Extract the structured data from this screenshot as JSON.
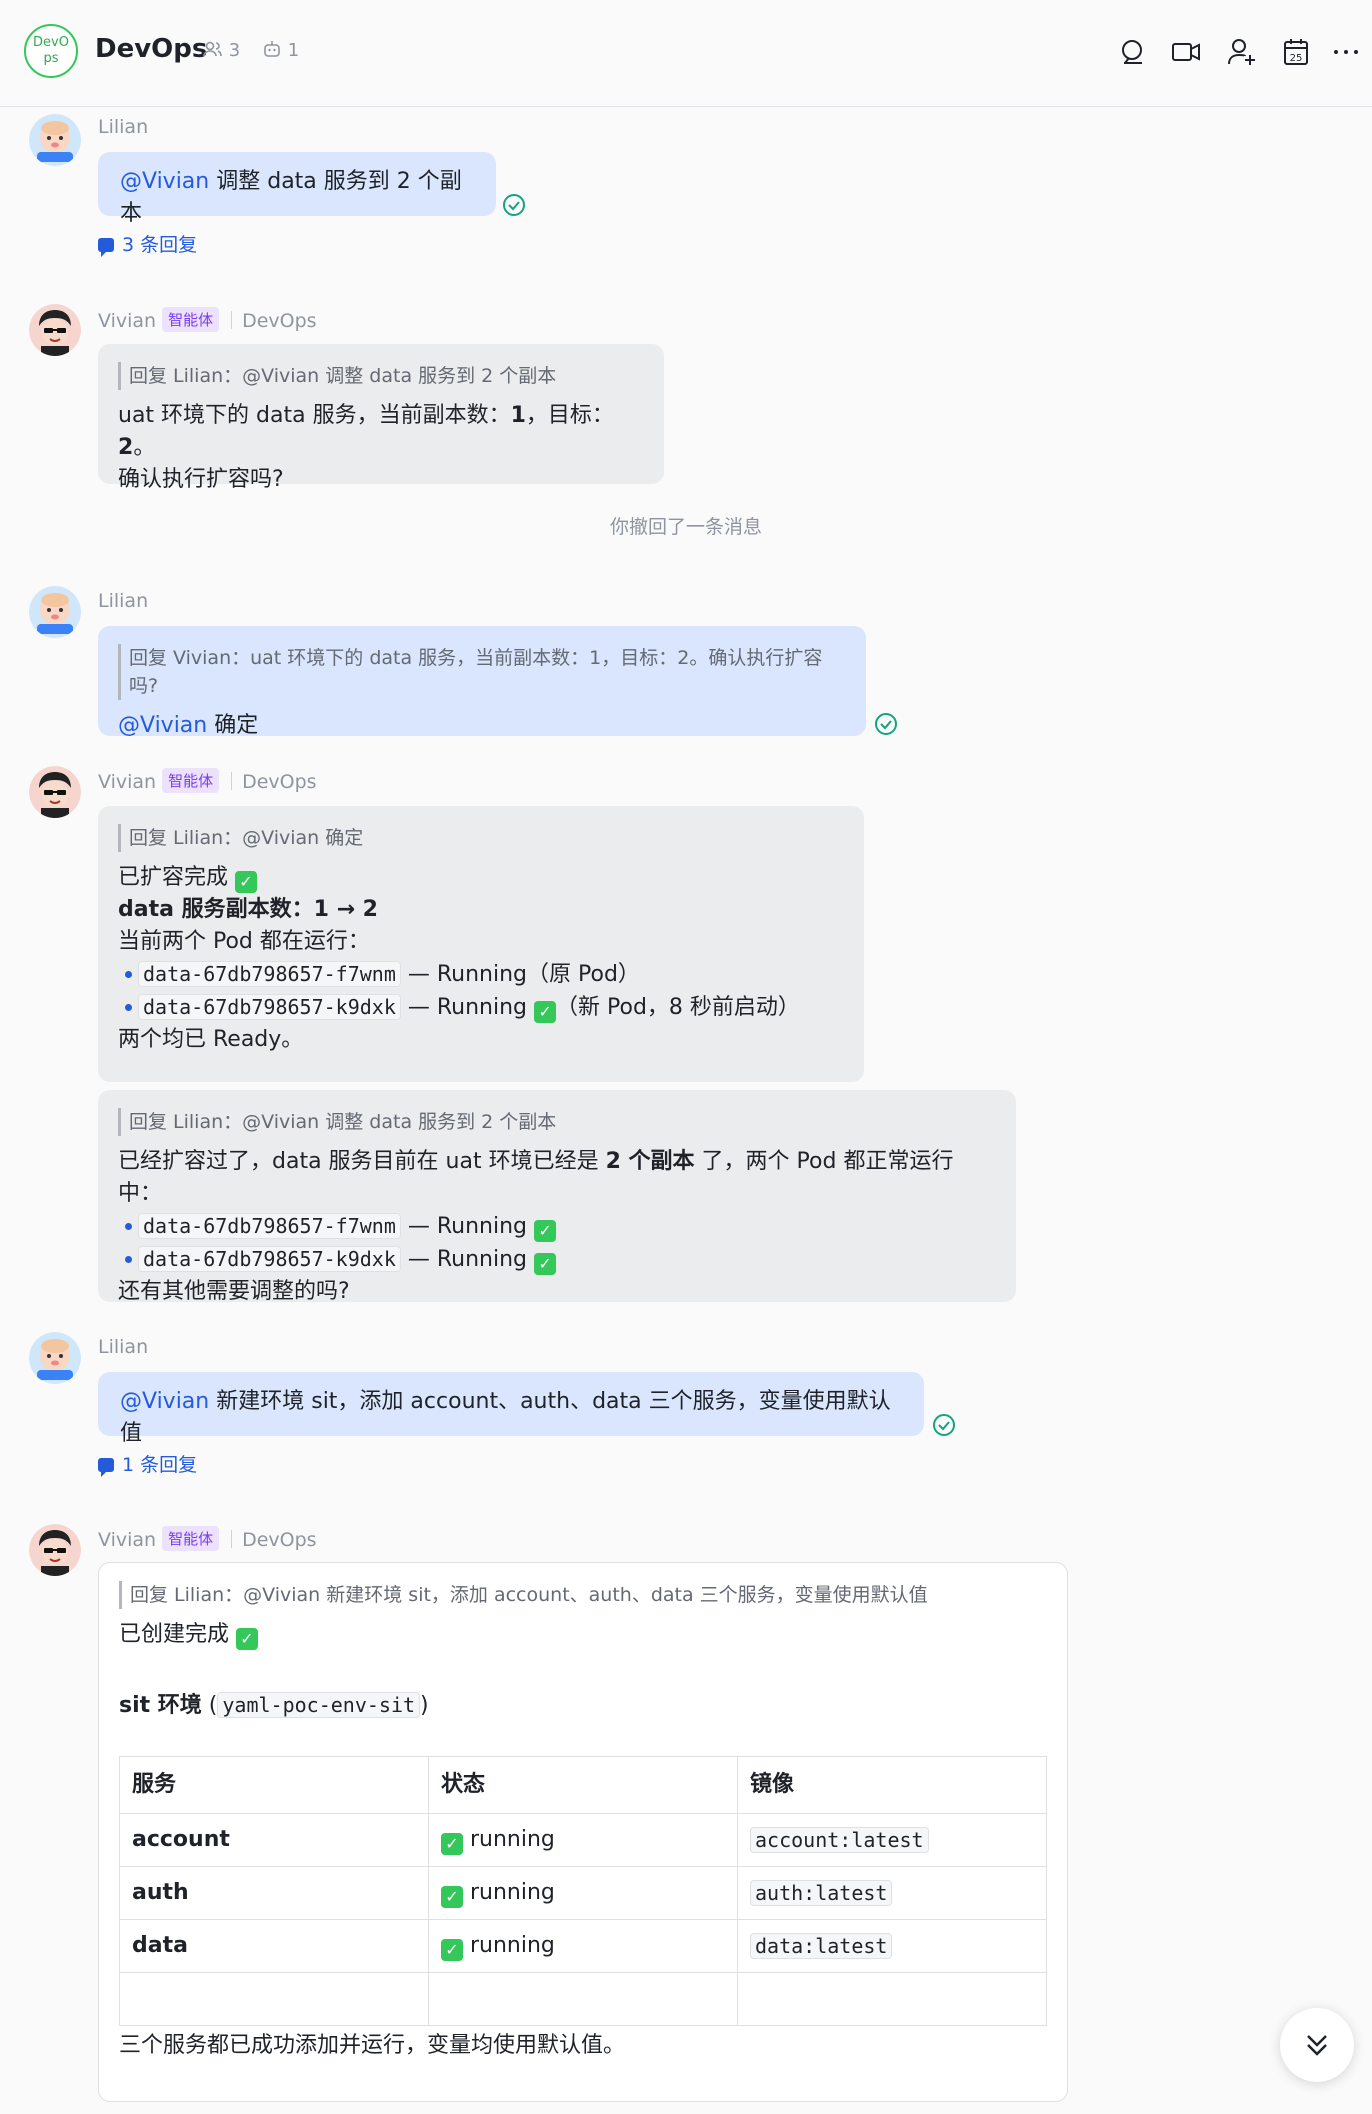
{
  "header": {
    "group_avatar_text": "DevOps",
    "title": "DevOps",
    "member_count": "3",
    "bot_count": "1",
    "icons": [
      "search-icon",
      "video-icon",
      "add-member-icon",
      "calendar-icon",
      "more-icon"
    ],
    "calendar_day": "25"
  },
  "msg1": {
    "sender": "Lilian",
    "mention": "@Vivian",
    "text": " 调整 data 服务到 2 个副本",
    "replies": "3 条回复"
  },
  "msg2": {
    "sender": "Vivian",
    "tag": "智能体",
    "group": "DevOps",
    "quote": "回复 Lilian：@Vivian 调整 data 服务到 2 个副本",
    "line1_a": "uat 环境下的 data 服务，当前副本数：",
    "line1_b": "1",
    "line1_c": "，目标：",
    "line1_d": "2",
    "line1_e": "。",
    "line2": "确认执行扩容吗?"
  },
  "system": {
    "recall": "你撤回了一条消息"
  },
  "msg3": {
    "sender": "Lilian",
    "quote": "回复 Vivian：uat 环境下的 data 服务，当前副本数：1，目标：2。确认执行扩容吗?",
    "mention": "@Vivian",
    "text": " 确定"
  },
  "msg4": {
    "sender": "Vivian",
    "tag": "智能体",
    "group": "DevOps",
    "quote": "回复 Lilian：@Vivian 确定",
    "l1": "已扩容完成 ",
    "l2": "data 服务副本数：1 → 2",
    "l3": "当前两个 Pod 都在运行：",
    "pod1": "data-67db798657-f7wnm",
    "pod1_status": " — Running（原 Pod）",
    "pod2": "data-67db798657-k9dxk",
    "pod2_status_a": " — Running ",
    "pod2_status_b": "（新 Pod，8 秒前启动）",
    "l6": "两个均已 Ready。"
  },
  "msg5": {
    "quote": "回复 Lilian：@Vivian 调整 data 服务到 2 个副本",
    "l1_a": "已经扩容过了，data 服务目前在 uat 环境已经是 ",
    "l1_b": "2 个副本",
    "l1_c": " 了，两个 Pod 都正常运行中：",
    "pod1": "data-67db798657-f7wnm",
    "pod2": "data-67db798657-k9dxk",
    "running": " — Running ",
    "l4": "还有其他需要调整的吗?"
  },
  "msg6": {
    "sender": "Lilian",
    "mention": "@Vivian",
    "text": " 新建环境 sit，添加 account、auth、data 三个服务，变量使用默认值",
    "replies": "1 条回复"
  },
  "msg7": {
    "sender": "Vivian",
    "tag": "智能体",
    "group": "DevOps",
    "quote": "回复 Lilian：@Vivian 新建环境 sit，添加 account、auth、data 三个服务，变量使用默认值",
    "l1": "已创建完成 ",
    "env_label": "sit 环境",
    "env_open": " (",
    "env_code": "yaml-poc-env-sit",
    "env_close": ")",
    "table": {
      "headers": [
        "服务",
        "状态",
        "镜像"
      ],
      "rows": [
        {
          "service": "account",
          "status": "running",
          "image": "account:latest"
        },
        {
          "service": "auth",
          "status": "running",
          "image": "auth:latest"
        },
        {
          "service": "data",
          "status": "running",
          "image": "data:latest"
        }
      ]
    },
    "footer": "三个服务都已成功添加并运行，变量均使用默认值。"
  },
  "checkmark": "✓",
  "colors": {
    "accent": "#245bdb",
    "self_bubble": "#d9e6fd",
    "other_bubble": "#ebecee",
    "agent_tag": "#7a3cf0",
    "read_check": "#14a37f"
  }
}
